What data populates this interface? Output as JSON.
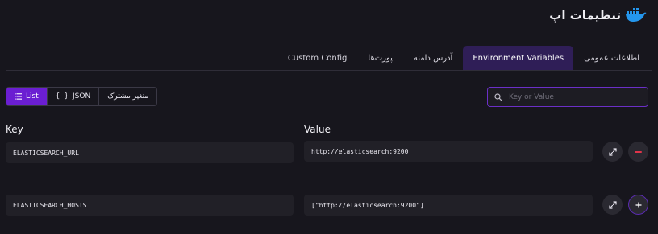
{
  "header": {
    "title": "تنظیمات اپ",
    "logo_icon": "docker-whale-icon"
  },
  "tabs": [
    {
      "label": "اطلاعات عمومی",
      "active": false
    },
    {
      "label": "Environment Variables",
      "active": true
    },
    {
      "label": "آدرس دامنه",
      "active": false
    },
    {
      "label": "پورت‌ها",
      "active": false
    },
    {
      "label": "Custom Config",
      "active": false
    }
  ],
  "view_toggle": {
    "list_label": "List",
    "json_label": "JSON",
    "shared_label": "متغیر مشترک",
    "active": "list"
  },
  "search": {
    "placeholder": "Key or Value",
    "value": ""
  },
  "columns": {
    "key": "Key",
    "value": "Value"
  },
  "env_vars": [
    {
      "key": "ELASTICSEARCH_URL",
      "value": "http://elasticsearch:9200",
      "action": "remove"
    },
    {
      "key": "ELASTICSEARCH_HOSTS",
      "value": "[\"http://elasticsearch:9200\"]",
      "action": "add"
    }
  ],
  "colors": {
    "accent": "#6b1ed2",
    "active_tab_bg": "#2f1e57",
    "danger": "#e0344a",
    "background": "#17161d"
  }
}
